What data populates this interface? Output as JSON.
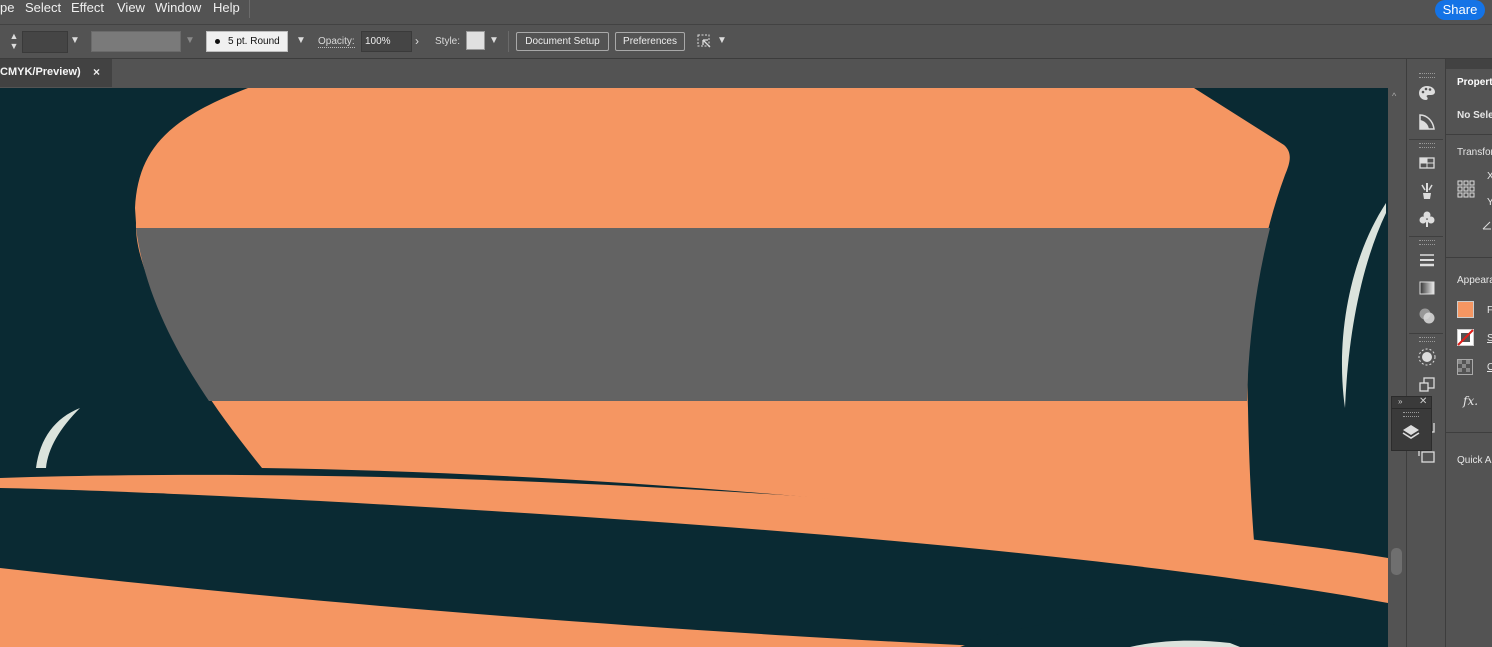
{
  "menu": {
    "items": [
      "pe",
      "Select",
      "Effect",
      "View",
      "Window",
      "Help"
    ],
    "share_label": "Share"
  },
  "control_bar": {
    "brush_label": "5 pt. Round",
    "opacity_label": "Opacity:",
    "opacity_value": "100%",
    "style_label": "Style:",
    "document_setup_label": "Document Setup",
    "preferences_label": "Preferences"
  },
  "document_tab": {
    "title": "CMYK/Preview)",
    "close_glyph": "×"
  },
  "properties_panel": {
    "tab_label": "Propert",
    "no_selection": "No Selec",
    "transform_label": "Transfor",
    "x_label": "X",
    "y_label": "Y",
    "appearance_label": "Appeara",
    "fill_label": "F",
    "stroke_label": "S",
    "opacity_label": "O",
    "fx_label": "fx.",
    "quick_actions_label": "Quick A"
  },
  "colors": {
    "canvas_bg": "#0a2a33",
    "orange": "#f59662",
    "gray_band": "#636363",
    "pale": "#dbe3dc",
    "accent": "#1473e6"
  },
  "icons": {
    "strip": [
      "palette-icon",
      "paint-icon",
      "swatches-icon",
      "brushes-icon",
      "symbols-icon",
      "stroke-icon",
      "gradient-icon",
      "transparency-icon",
      "appearance-icon",
      "graphic-styles-icon",
      "artboards-icon",
      "asset-export-icon"
    ],
    "float": "layers-icon"
  }
}
